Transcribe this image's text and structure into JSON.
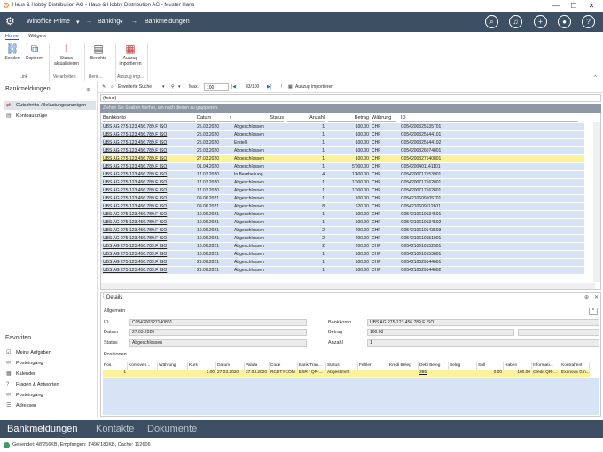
{
  "window": {
    "title": "Haus & Hobby Distribution AG - Haus & Hobby Distribution AG - Muster Hans"
  },
  "nav": {
    "app": "Winoffice Prime",
    "area": "Banking",
    "page": "Bankmeldungen",
    "arrow": "→"
  },
  "ribbon": {
    "tabs": [
      "Home",
      "Widgets"
    ],
    "buttons": {
      "senden": "Senden",
      "kopieren": "Kopieren",
      "status": "Status aktualisieren",
      "berichte": "Berichte",
      "auszug": "Auszug importieren"
    },
    "groups": {
      "link": "Link",
      "verarbeiten": "Verarbeiten",
      "berichte": "Beric...",
      "auszug": "Auszug imp..."
    }
  },
  "sidebar": {
    "title": "Bankmeldungen",
    "items": [
      "Gutschrifts-/Belastungsanzeigen",
      "Kontoauszüge"
    ],
    "favorites_title": "Favoriten",
    "favorites": [
      "Meine Aufgaben",
      "Posteingang",
      "Kalender",
      "Fragen & Antworten",
      "Posteingang",
      "Adressen"
    ]
  },
  "toolbar": {
    "search": "Erweiterte Suche",
    "max_label": "Max.",
    "max_value": "100",
    "pager": "83/100",
    "import": "Auszug importieren"
  },
  "grid": {
    "filter": "(keine)",
    "group_hint": "Ziehen Sie Spalten hierher, um nach diesen zu gruppieren.",
    "columns": [
      "Bankkonto",
      "Datum",
      "Status",
      "Anzahl",
      "Betrag",
      "Währung",
      "ID"
    ],
    "rows": [
      [
        "UBS AG 275-123.456.789.F ISO",
        "25.03.2020",
        "Abgeschlossen",
        "1",
        "100.00",
        "CHF",
        "C054200325135701"
      ],
      [
        "UBS AG 275-123.456.789.F ISO",
        "25.03.2020",
        "Abgeschlossen",
        "1",
        "100.00",
        "CHF",
        "C054200325144101"
      ],
      [
        "UBS AG 275-123.456.789.F ISO",
        "25.03.2020",
        "Erstellt",
        "1",
        "100.00",
        "CHF",
        "C054200325144102"
      ],
      [
        "UBS AG 275-123.456.789.F ISO",
        "26.03.2020",
        "Abgeschlossen",
        "1",
        "100.00",
        "CHF",
        "C054200326074801"
      ],
      [
        "UBS AG 275-123.456.789.F ISO",
        "27.03.2020",
        "Abgeschlossen",
        "1",
        "100.00",
        "CHF",
        "C054200327140801"
      ],
      [
        "UBS AG 275-123.456.789.F ISO",
        "01.04.2020",
        "Abgeschlossen",
        "1",
        "5'000.00",
        "CHF",
        "C054200401141101"
      ],
      [
        "UBS AG 275-123.456.789.F ISO",
        "17.07.2020",
        "In Bearbeitung",
        "4",
        "1'400.00",
        "CHF",
        "C054200717153901"
      ],
      [
        "UBS AG 275-123.456.789.F ISO",
        "17.07.2020",
        "Abgeschlossen",
        "1",
        "1'000.00",
        "CHF",
        "C054200717162001"
      ],
      [
        "UBS AG 275-123.456.789.F ISO",
        "17.07.2020",
        "Abgeschlossen",
        "1",
        "1'000.00",
        "CHF",
        "C054200717162801"
      ],
      [
        "UBS AG 275-123.456.789.F ISO",
        "09.06.2021",
        "Abgeschlossen",
        "1",
        "100.00",
        "CHF",
        "C054210609105701"
      ],
      [
        "UBS AG 275-123.456.789.F ISO",
        "09.06.2021",
        "Abgeschlossen",
        "8",
        "620.00",
        "CHF",
        "C054210609112601"
      ],
      [
        "UBS AG 275-123.456.789.F ISO",
        "10.06.2021",
        "Abgeschlossen",
        "1",
        "100.00",
        "CHF",
        "C054210610134501"
      ],
      [
        "UBS AG 275-123.456.789.F ISO",
        "10.06.2021",
        "Abgeschlossen",
        "1",
        "100.00",
        "CHF",
        "C054210610134502"
      ],
      [
        "UBS AG 275-123.456.789.F ISO",
        "10.06.2021",
        "Abgeschlossen",
        "2",
        "200.00",
        "CHF",
        "C054210610143503"
      ],
      [
        "UBS AG 275-123.456.789.F ISO",
        "10.06.2021",
        "Abgeschlossen",
        "2",
        "200.00",
        "CHF",
        "C054210610151901"
      ],
      [
        "UBS AG 275-123.456.789.F ISO",
        "10.06.2021",
        "Abgeschlossen",
        "2",
        "200.00",
        "CHF",
        "C054210610152501"
      ],
      [
        "UBS AG 275-123.456.789.F ISO",
        "10.06.2021",
        "Abgeschlossen",
        "1",
        "100.00",
        "CHF",
        "C054210610153801"
      ],
      [
        "UBS AG 275-123.456.789.F ISO",
        "29.06.2021",
        "Abgeschlossen",
        "1",
        "100.00",
        "CHF",
        "C054210629144601"
      ],
      [
        "UBS AG 275-123.456.789.F ISO",
        "29.06.2021",
        "Abgeschlossen",
        "1",
        "100.00",
        "CHF",
        "C054210629144602"
      ]
    ],
    "selected_index": 4
  },
  "details": {
    "title": "Details",
    "section": "Allgemein",
    "labels": {
      "id": "ID",
      "datum": "Datum",
      "status": "Status",
      "bankkonto": "Bankkonto",
      "betrag": "Betrag",
      "anzahl": "Anzahl"
    },
    "values": {
      "id": "C054200327140801",
      "datum": "27.03.2020",
      "status": "Abgeschlossen",
      "bankkonto": "UBS AG 275-123.456.789.F ISO",
      "betrag": "100.00",
      "anzahl": "1"
    },
    "positions_title": "Positionen",
    "pos_columns": [
      "Pos.",
      "Kontoveh...",
      "Währung",
      "Kurs",
      "Datum",
      "Valuta",
      "Code",
      "Bank Tran...",
      "Status",
      "Fehler",
      "Kredi Beleg",
      "Debi Beleg",
      "Beleg",
      "Soll",
      "Haben",
      "Informati...",
      "Kontrahent"
    ],
    "pos_row": [
      "1",
      "",
      "",
      "1.00",
      "27.03.2020",
      "27.03.2020",
      "RCDTYCOM",
      "ESR / QR-...",
      "Abgestimmt",
      "",
      "",
      "395",
      "",
      "0.00",
      "100.00",
      "Credit QR-...",
      "Exanova Gm..."
    ]
  },
  "bottom_tabs": [
    "Bankmeldungen",
    "Kontakte",
    "Dokumente"
  ],
  "status": {
    "text": "Gesendet: 48'256KB, Empfangen: 1'496'180KB, Cache: 112606"
  }
}
